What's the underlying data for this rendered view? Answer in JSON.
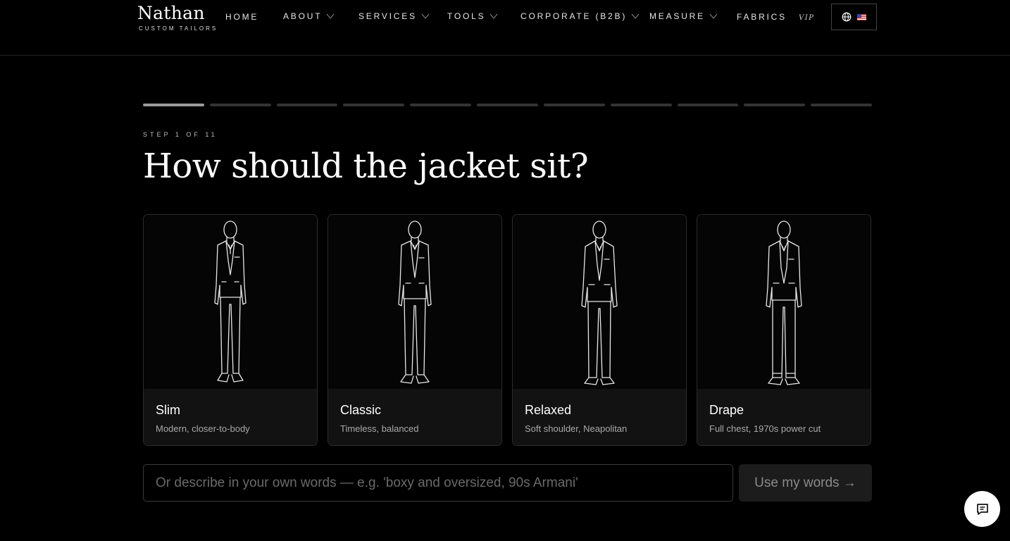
{
  "brand": {
    "name": "Nathan",
    "tagline": "CUSTOM TAILORS"
  },
  "nav": {
    "home": "HOME",
    "about": "ABOUT",
    "services": "SERVICES",
    "tools": "TOOLS",
    "corporate": "CORPORATE (B2B)",
    "measure": "MEASURE",
    "fabrics": "FABRICS",
    "vip": "VIP"
  },
  "language": {
    "icon": "globe-icon",
    "flag": "us-flag-icon"
  },
  "progress": {
    "current": 1,
    "total": 11
  },
  "step": {
    "label": "STEP 1 OF 11"
  },
  "question": "How should the jacket sit?",
  "options": [
    {
      "title": "Slim",
      "description": "Modern, closer-to-body"
    },
    {
      "title": "Classic",
      "description": "Timeless, balanced"
    },
    {
      "title": "Relaxed",
      "description": "Soft shoulder, Neapolitan"
    },
    {
      "title": "Drape",
      "description": "Full chest, 1970s power cut"
    }
  ],
  "describe": {
    "placeholder": "Or describe in your own words — e.g. 'boxy and oversized, 90s Armani'",
    "value": ""
  },
  "submit_label": "Use my words →",
  "chat": {
    "icon": "chat-icon"
  },
  "colors": {
    "background": "#000000",
    "card_footer": "#121212",
    "progress_active": "#9a9a9a",
    "progress_inactive": "#333333"
  }
}
